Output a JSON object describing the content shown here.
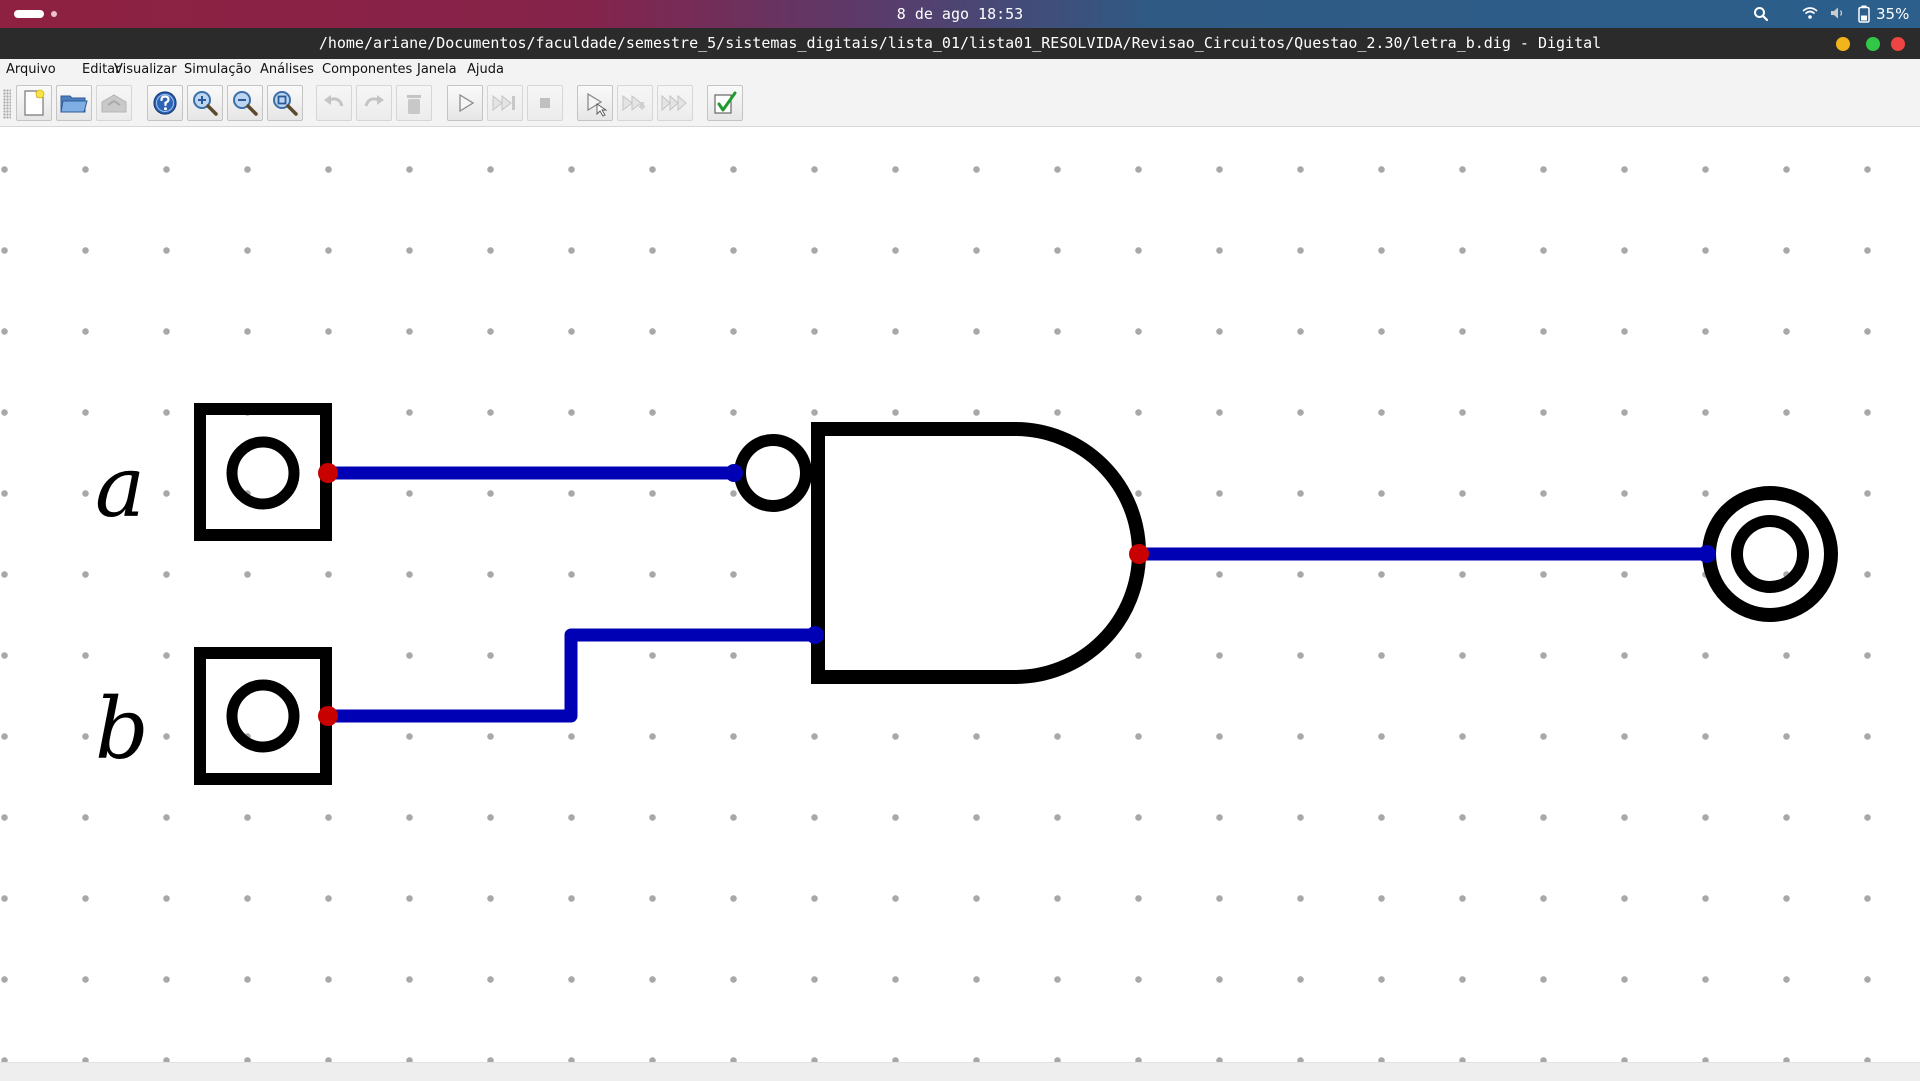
{
  "topbar": {
    "clock": "8 de ago  18:53",
    "battery": "35%",
    "icons": [
      "activities-indicator",
      "search-icon",
      "wifi-icon",
      "volume-icon",
      "battery-icon"
    ]
  },
  "window": {
    "title": "/home/ariane/Documentos/faculdade/semestre_5/sistemas_digitais/lista_01/lista01_RESOLVIDA/Revisao_Circuitos/Questao_2.30/letra_b.dig - Digital",
    "controls": [
      "minimize",
      "maximize",
      "close"
    ]
  },
  "menubar": {
    "items": [
      "Arquivo",
      "Editar",
      "Visualizar",
      "Simulação",
      "Análises",
      "Componentes",
      "Janela",
      "Ajuda"
    ]
  },
  "toolbar": {
    "buttons": [
      {
        "name": "new-file-icon",
        "enabled": true
      },
      {
        "name": "open-folder-icon",
        "enabled": true
      },
      {
        "name": "save-icon",
        "enabled": false
      },
      {
        "name": "help-icon",
        "enabled": true
      },
      {
        "name": "zoom-in-icon",
        "enabled": true
      },
      {
        "name": "zoom-out-icon",
        "enabled": true
      },
      {
        "name": "zoom-fit-icon",
        "enabled": true
      },
      {
        "name": "undo-icon",
        "enabled": false
      },
      {
        "name": "redo-icon",
        "enabled": false
      },
      {
        "name": "delete-icon",
        "enabled": false
      },
      {
        "name": "run-simulation-icon",
        "enabled": true
      },
      {
        "name": "step-icon",
        "enabled": false
      },
      {
        "name": "stop-icon",
        "enabled": false
      },
      {
        "name": "single-step-icon",
        "enabled": true
      },
      {
        "name": "run-to-break-icon",
        "enabled": false
      },
      {
        "name": "fast-forward-icon",
        "enabled": false
      },
      {
        "name": "test-check-icon",
        "enabled": true
      }
    ]
  },
  "circuit": {
    "inputs": [
      {
        "label": "a"
      },
      {
        "label": "b"
      }
    ],
    "gate": {
      "type": "AND",
      "inverted_inputs": [
        "a"
      ]
    },
    "outputs": [
      {
        "label": ""
      }
    ],
    "colors": {
      "wire": "#0000b4",
      "pin": "#c80000",
      "component": "#000000",
      "grid_dot": "#a8a8a8"
    }
  }
}
